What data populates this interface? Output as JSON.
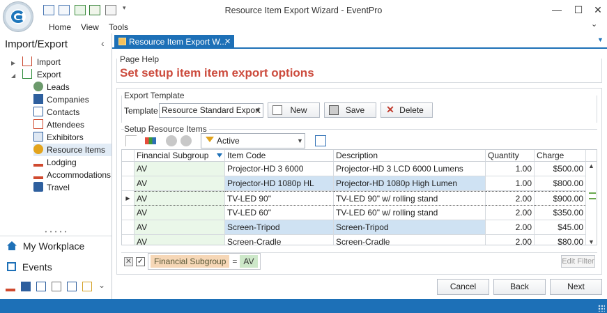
{
  "app": {
    "window_title": "Resource Item Export Wizard - EventPro",
    "menu": [
      "Home",
      "View",
      "Tools"
    ]
  },
  "window_controls": {
    "minimize": "—",
    "maximize": "☐",
    "close": "✕",
    "ribbon_collapse": "⌄"
  },
  "nav": {
    "title": "Import/Export",
    "collapse_glyph": "‹",
    "tree": [
      {
        "label": "Import",
        "expander": "▶",
        "icon": "import-icon"
      },
      {
        "label": "Export",
        "expander": "◢",
        "icon": "export-icon"
      }
    ],
    "children": [
      {
        "label": "Leads",
        "icon": "leads-icon"
      },
      {
        "label": "Companies",
        "icon": "companies-icon"
      },
      {
        "label": "Contacts",
        "icon": "contacts-icon"
      },
      {
        "label": "Attendees",
        "icon": "attendees-icon"
      },
      {
        "label": "Exhibitors",
        "icon": "exhibitors-icon"
      },
      {
        "label": "Resource Items",
        "icon": "resource-items-icon",
        "selected": true
      },
      {
        "label": "Lodging",
        "icon": "lodging-icon"
      },
      {
        "label": "Accommodations",
        "icon": "accommodations-icon"
      },
      {
        "label": "Travel",
        "icon": "travel-icon"
      }
    ],
    "splitter_glyph": "• • • • •",
    "big_items": [
      {
        "label": "My Workplace",
        "icon": "home-icon"
      },
      {
        "label": "Events",
        "icon": "events-icon"
      }
    ],
    "more_glyph": "⌄"
  },
  "doc_tab": {
    "label": "Resource Item Export W...",
    "close": "✕",
    "dropdown": "▼"
  },
  "page_help": {
    "label": "Page Help",
    "text": "Set setup item item export options"
  },
  "export_template": {
    "group_label": "Export Template",
    "field_label": "Template",
    "value": "Resource Standard Export",
    "buttons": {
      "new": "New",
      "save": "Save",
      "delete": "Delete"
    }
  },
  "setup_items": {
    "group_label": "Setup Resource Items",
    "filter_value": "Active",
    "columns": [
      "Financial Subgroup",
      "Item Code",
      "Description",
      "Quantity",
      "Charge"
    ],
    "rows": [
      {
        "fs": "AV",
        "code": "Projector-HD 3 6000",
        "desc": "Projector-HD 3 LCD 6000 Lumens",
        "qty": "1.00",
        "charge": "$500.00",
        "selected": false,
        "focused": false
      },
      {
        "fs": "AV",
        "code": "Projector-HD 1080p HL",
        "desc": "Projector-HD 1080p High Lumen",
        "qty": "1.00",
        "charge": "$800.00",
        "selected": true,
        "focused": false
      },
      {
        "fs": "AV",
        "code": "TV-LED 90\"",
        "desc": "TV-LED 90\" w/ rolling stand",
        "qty": "2.00",
        "charge": "$900.00",
        "selected": false,
        "focused": true
      },
      {
        "fs": "AV",
        "code": "TV-LED 60\"",
        "desc": "TV-LED 60\" w/ rolling stand",
        "qty": "2.00",
        "charge": "$350.00",
        "selected": false,
        "focused": false
      },
      {
        "fs": "AV",
        "code": "Screen-Tripod",
        "desc": "Screen-Tripod",
        "qty": "2.00",
        "charge": "$45.00",
        "selected": true,
        "focused": false
      },
      {
        "fs": "AV",
        "code": "Screen-Cradle",
        "desc": "Screen-Cradle",
        "qty": "2.00",
        "charge": "$80.00",
        "selected": false,
        "focused": false
      }
    ],
    "focus_indicator": "▶",
    "scroll_up": "▲",
    "scroll_down": "▼"
  },
  "filter_panel": {
    "clear_glyph": "✕",
    "check_glyph": "✓",
    "field": "Financial Subgroup",
    "operator": "=",
    "value": "AV",
    "edit_filter": "Edit Filter"
  },
  "wizard_buttons": {
    "cancel": "Cancel",
    "back": "Back",
    "next": "Next"
  },
  "colors": {
    "accent": "#1d70b7",
    "help_text": "#cc4b3d",
    "selection": "#cfe2f3",
    "subgroup_bg": "#eaf7e9"
  }
}
